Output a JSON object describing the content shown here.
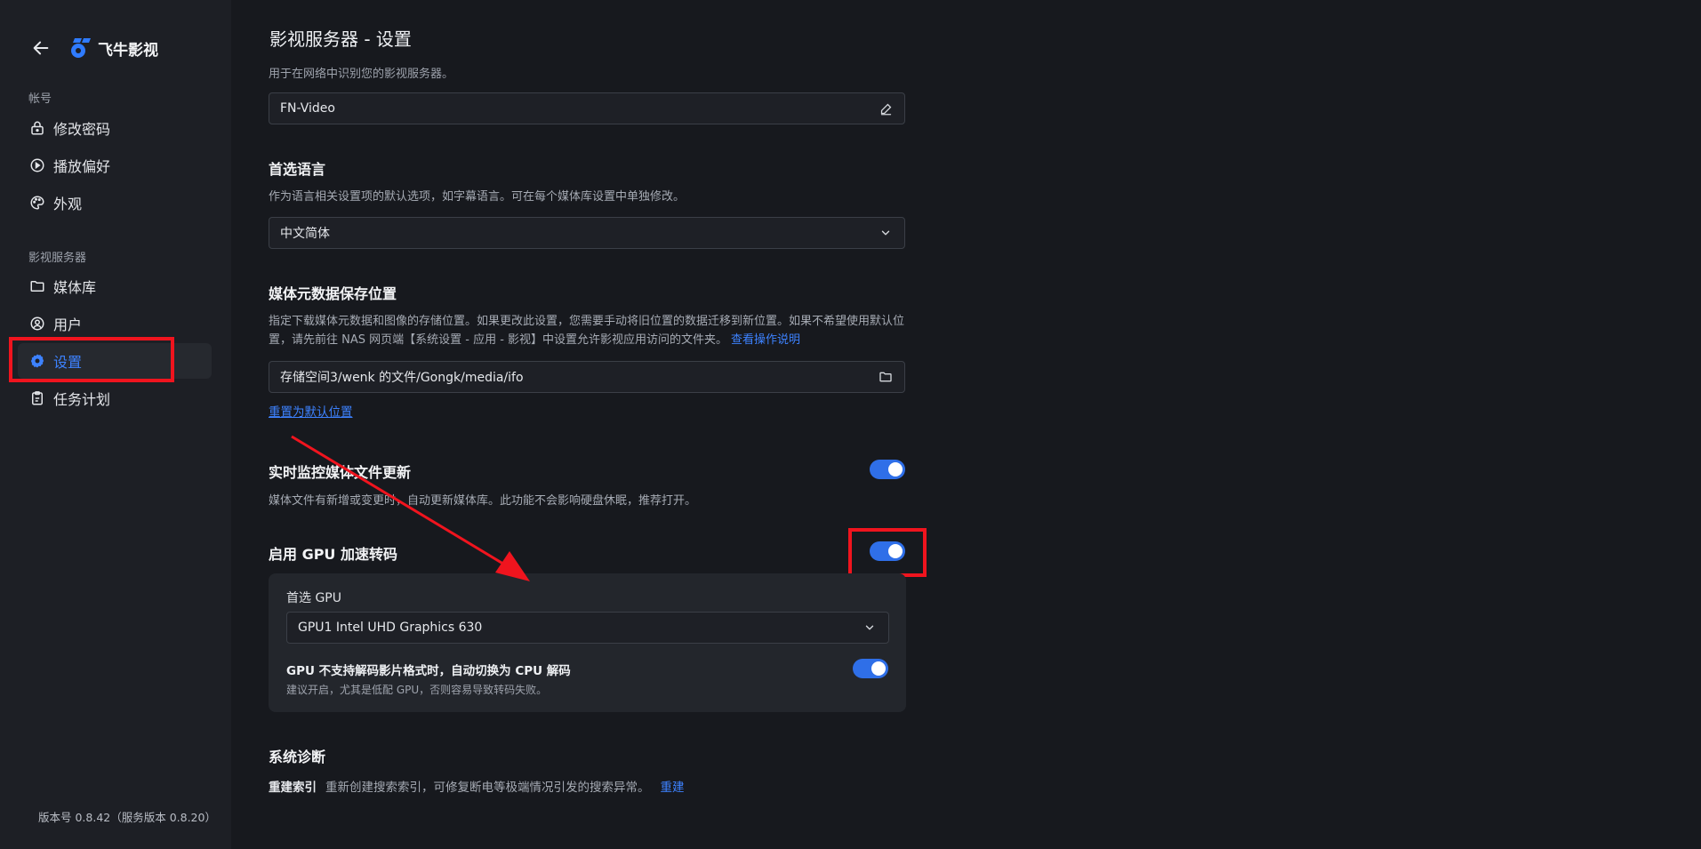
{
  "app": {
    "title": "飞牛影视"
  },
  "sidebar": {
    "section_account": "帐号",
    "account_items": [
      {
        "label": "修改密码",
        "icon": "lock-icon"
      },
      {
        "label": "播放偏好",
        "icon": "play-circle-icon"
      },
      {
        "label": "外观",
        "icon": "palette-icon"
      }
    ],
    "section_server": "影视服务器",
    "server_items": [
      {
        "label": "媒体库",
        "icon": "folder-icon"
      },
      {
        "label": "用户",
        "icon": "user-circle-icon"
      },
      {
        "label": "设置",
        "icon": "gear-icon",
        "active": true
      },
      {
        "label": "任务计划",
        "icon": "clipboard-icon"
      }
    ],
    "version": "版本号 0.8.42（服务版本 0.8.20）"
  },
  "page": {
    "title": "影视服务器 - 设置",
    "server_name": {
      "description": "用于在网络中识别您的影视服务器。",
      "value": "FN-Video"
    },
    "language": {
      "title": "首选语言",
      "description": "作为语言相关设置项的默认选项，如字幕语言。可在每个媒体库设置中单独修改。",
      "selected": "中文简体"
    },
    "metadata": {
      "title": "媒体元数据保存位置",
      "description": "指定下载媒体元数据和图像的存储位置。如果更改此设置，您需要手动将旧位置的数据迁移到新位置。如果不希望使用默认位置，请先前往 NAS 网页端【系统设置 - 应用 - 影视】中设置允许影视应用访问的文件夹。",
      "help_link": "查看操作说明",
      "path": "存储空间3/wenk 的文件/Gongk/media/ifo",
      "reset_link": "重置为默认位置"
    },
    "realtime_monitor": {
      "title": "实时监控媒体文件更新",
      "description": "媒体文件有新增或变更时，自动更新媒体库。此功能不会影响硬盘休眠，推荐打开。",
      "enabled": true
    },
    "gpu": {
      "title": "启用 GPU 加速转码",
      "enabled": true,
      "preferred_label": "首选 GPU",
      "preferred_value": "GPU1 Intel UHD Graphics 630",
      "fallback_title": "GPU 不支持解码影片格式时，自动切换为 CPU 解码",
      "fallback_desc": "建议开启，尤其是低配 GPU，否则容易导致转码失败。",
      "fallback_enabled": true
    },
    "diagnostics": {
      "title": "系统诊断",
      "rebuild_label": "重建索引",
      "rebuild_desc": "重新创建搜索索引，可修复断电等极端情况引发的搜索异常。",
      "rebuild_link": "重建"
    }
  },
  "colors": {
    "accent": "#3d82ff",
    "annotation_red": "#f0141e",
    "background": "#17191e",
    "sidebar": "#1d1f25"
  }
}
